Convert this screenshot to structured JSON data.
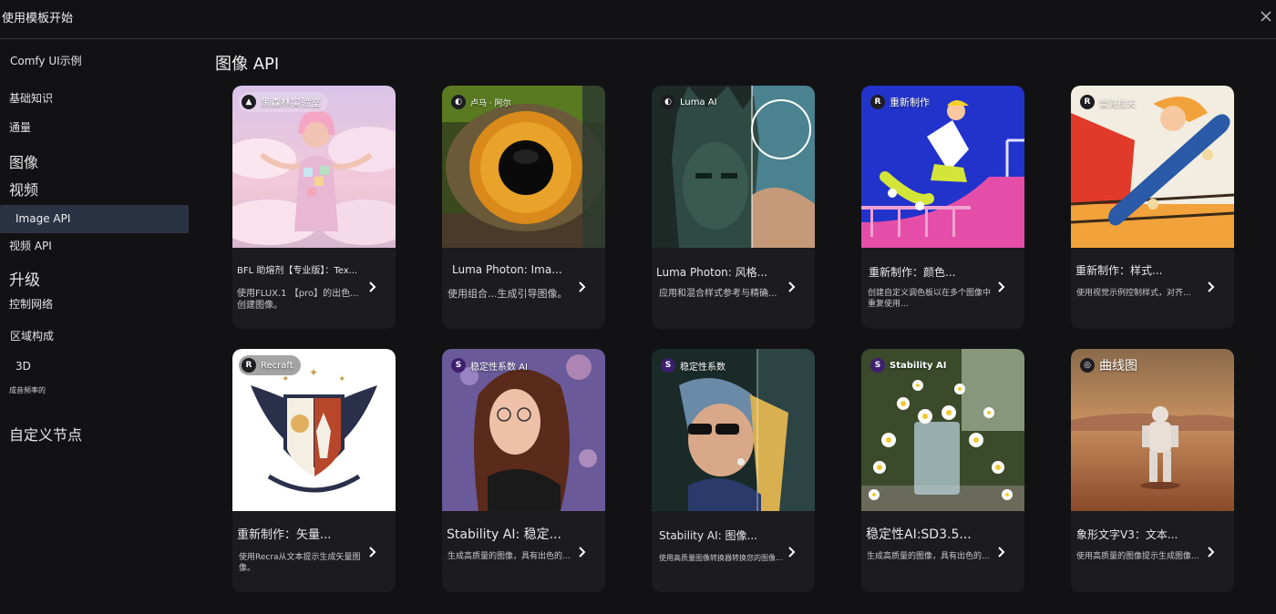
{
  "window": {
    "title": "使用模板开始"
  },
  "sidebar": {
    "items": [
      {
        "label": "Comfy UI示例",
        "size": 12
      },
      {
        "label": "基础知识",
        "size": 12
      },
      {
        "label": "通量",
        "size": 12
      },
      {
        "label": "图像",
        "size": 16
      },
      {
        "label": "视频",
        "size": 16
      },
      {
        "label": "Image API",
        "size": 12
      },
      {
        "label": "视频 API",
        "size": 12
      },
      {
        "label": "升级",
        "size": 17
      },
      {
        "label": "控制网络",
        "size": 12
      },
      {
        "label": "区域构成",
        "size": 12
      },
      {
        "label": "3D",
        "size": 12
      },
      {
        "label": "成音频率的",
        "size": 8
      },
      {
        "label": "自定义节点",
        "size": 16
      }
    ],
    "active_index": 5
  },
  "main": {
    "section_title": "图像 API",
    "cards": [
      {
        "badge": "黑森林实验室",
        "title": "BFL 助熔剂【专业版】：Tex...",
        "desc": "使用FLUX.1 【pro】的出色...创建图像。",
        "art": "clouds-girl"
      },
      {
        "badge": "卢马 · 阿尔",
        "title": "Luma Photon: Ima...",
        "desc": "使用组合...生成引导图像。",
        "art": "eye"
      },
      {
        "badge": "Luma AI",
        "title": "Luma Photon: 风格...",
        "desc": "应用和混合样式参考与精确...",
        "art": "statue"
      },
      {
        "badge": "重新制作",
        "title": "重新制作：颜色...",
        "desc": "创建自定义调色板以在多个图像中重复使用...",
        "art": "skater"
      },
      {
        "badge": "雷克拉夫",
        "title": "重新制作：样式...",
        "desc": "使用视觉示例控制样式，对齐...",
        "art": "skateboard"
      },
      {
        "badge": "Recraft",
        "title": "重新制作：矢量...",
        "desc": "使用Recra从文本提示生成矢量图像。",
        "art": "crest"
      },
      {
        "badge": "稳定性系数 AI",
        "title": "Stability AI: 稳定...",
        "desc": "生成高质量的图像，具有出色的...",
        "art": "portrait"
      },
      {
        "badge": "稳定性系数",
        "title": "Stability AI: 图像...",
        "desc": "使用高质量图像转换器转换您的图像...",
        "art": "pearl"
      },
      {
        "badge": "Stability AI",
        "title": "稳定性AI:SD3.5...",
        "desc": "生成高质量的图像，具有出色的...",
        "art": "flowers"
      },
      {
        "badge": "曲线图",
        "title": "象形文字V3：文本...",
        "desc": "使用高质量的图像提示生成图像...",
        "art": "astronaut"
      }
    ]
  },
  "colors": {
    "background": "#121214",
    "card": "#1c1c1f",
    "active_nav": "#2a3344"
  }
}
